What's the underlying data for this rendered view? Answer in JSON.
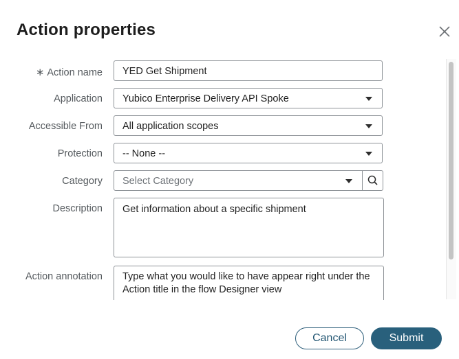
{
  "dialog": {
    "title": "Action properties",
    "close_icon": "close-icon"
  },
  "form": {
    "action_name": {
      "label": "Action name",
      "required": true,
      "required_marker": "∗",
      "value": "YED Get Shipment"
    },
    "application": {
      "label": "Application",
      "value": "Yubico Enterprise Delivery API Spoke"
    },
    "accessible_from": {
      "label": "Accessible From",
      "value": "All application scopes"
    },
    "protection": {
      "label": "Protection",
      "value": "-- None --"
    },
    "category": {
      "label": "Category",
      "placeholder": "Select Category",
      "lookup_icon": "search-icon"
    },
    "description": {
      "label": "Description",
      "value": "Get information about a specific shipment"
    },
    "action_annotation": {
      "label": "Action annotation",
      "placeholder": "Type what you would like to have appear right under the Action title in the flow Designer view"
    }
  },
  "footer": {
    "cancel_label": "Cancel",
    "submit_label": "Submit"
  },
  "colors": {
    "primary": "#29607c",
    "border": "#8c9196",
    "label": "#555a5e"
  }
}
